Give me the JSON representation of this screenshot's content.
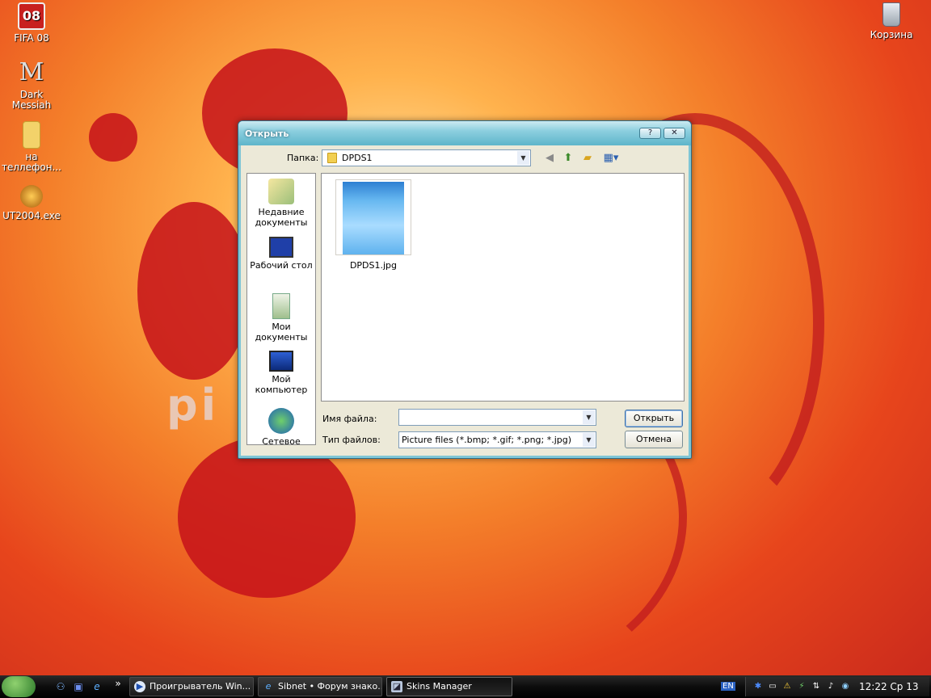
{
  "desktop": {
    "icons": [
      {
        "label": "FIFA 08"
      },
      {
        "label": "Dark\nMessiah"
      },
      {
        "label": "на\nтеллефон..."
      },
      {
        "label": "UT2004.exe"
      },
      {
        "label": "Корзина"
      }
    ],
    "wallpaper_text": "pi"
  },
  "dialog": {
    "title": "Открыть",
    "help_button": "?",
    "close_button": "✕",
    "look_in_label": "Папка:",
    "look_in_value": "DPDS1",
    "places": [
      {
        "label": "Недавние документы"
      },
      {
        "label": "Рабочий стол"
      },
      {
        "label": "Мои документы"
      },
      {
        "label": "Мой компьютер"
      },
      {
        "label": "Сетевое"
      }
    ],
    "files": [
      {
        "name": "DPDS1.jpg"
      }
    ],
    "file_name_label": "Имя файла:",
    "file_name_value": "",
    "file_type_label": "Тип файлов:",
    "file_type_value": "Picture files (*.bmp; *.gif; *.png; *.jpg)",
    "open_button": "Открыть",
    "cancel_button": "Отмена"
  },
  "taskbar": {
    "tasks": [
      {
        "label": "Проигрыватель Win..."
      },
      {
        "label": "Sibnet • Форум знако..."
      },
      {
        "label": "Skins Manager"
      }
    ],
    "overflow": "»",
    "language": "EN",
    "clock": "12:22 Ср 13"
  }
}
